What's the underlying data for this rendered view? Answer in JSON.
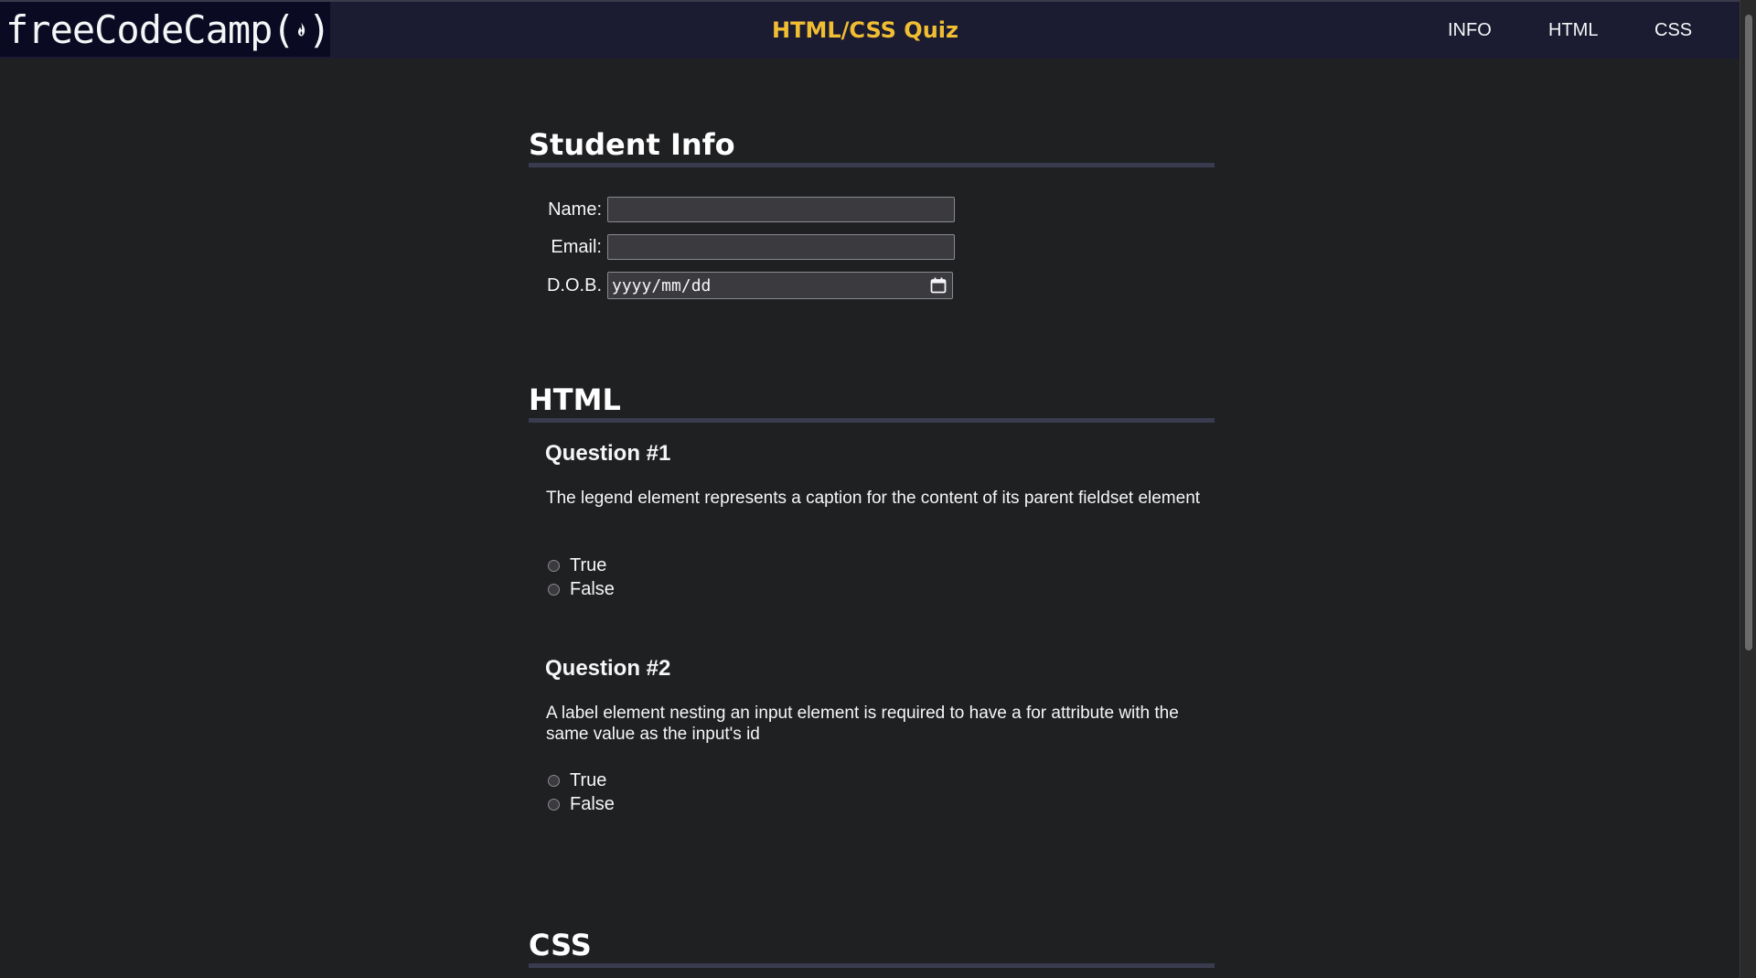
{
  "nav": {
    "logo_text": "freeCodeCamp(",
    "logo_close": ")",
    "title": "HTML/CSS Quiz",
    "links": [
      "INFO",
      "HTML",
      "CSS"
    ]
  },
  "student_info": {
    "heading": "Student Info",
    "name_label": "Name:",
    "email_label": "Email:",
    "dob_label": "D.O.B.",
    "dob_placeholder": "yyyy/mm/dd"
  },
  "html_section": {
    "heading": "HTML",
    "questions": [
      {
        "title": "Question #1",
        "text": "The legend element represents a caption for the content of its parent fieldset element",
        "options": [
          "True",
          "False"
        ]
      },
      {
        "title": "Question #2",
        "text": "A label element nesting an input element is required to have a for attribute with the same value as the input's id",
        "options": [
          "True",
          "False"
        ]
      }
    ]
  },
  "css_section": {
    "heading": "CSS"
  },
  "colors": {
    "nav_bg": "#1b1b32",
    "logo_bg": "#0a0a23",
    "title_accent": "#f1be32",
    "page_bg": "#1f2022",
    "divider": "#3b3b4f"
  },
  "icons": {
    "logo": "flame-icon",
    "date": "calendar-icon"
  }
}
